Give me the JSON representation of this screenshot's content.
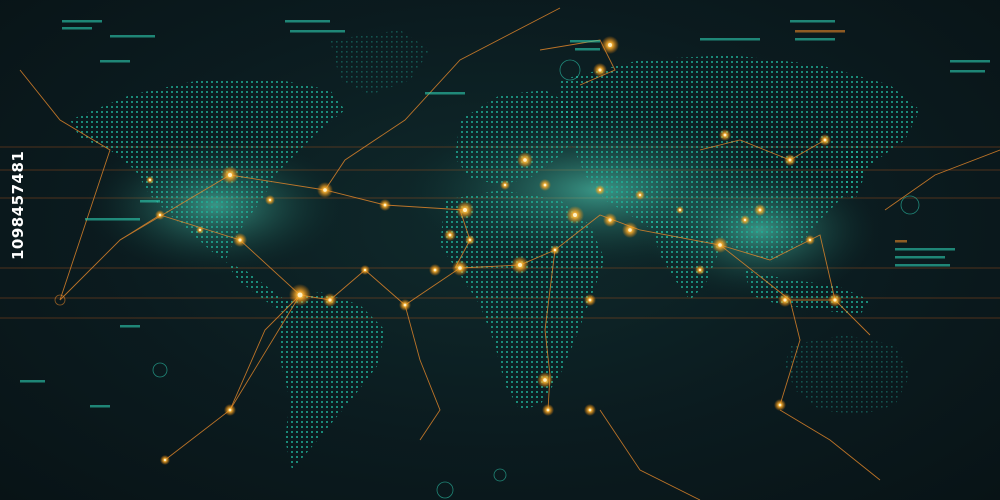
{
  "image": {
    "description_kind": "stock-photo",
    "subject": "digital-world-map-network",
    "colors": {
      "background": "#0b1a1e",
      "land_dots": "#1fae96",
      "land_dots_bright": "#39e0c0",
      "city_glow": "#ffb22e",
      "city_core": "#fff1c4",
      "links": "#e8892a",
      "hud_lines": "#b3561c"
    }
  },
  "watermark": {
    "stock_id": "1098457481"
  }
}
